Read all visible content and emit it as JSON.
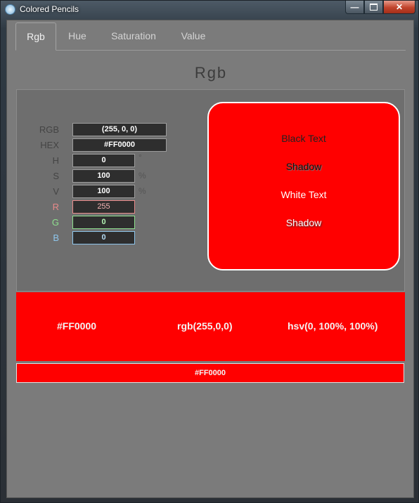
{
  "window": {
    "title": "Colored Pencils"
  },
  "tabs": [
    {
      "label": "Rgb"
    },
    {
      "label": "Hue"
    },
    {
      "label": "Saturation"
    },
    {
      "label": "Value"
    }
  ],
  "heading": "Rgb",
  "fields": {
    "rgb": {
      "label": "RGB",
      "value": "(255, 0, 0)"
    },
    "hex": {
      "label": "HEX",
      "value": "#FF0000"
    },
    "h": {
      "label": "H",
      "value": "0",
      "unit": "°"
    },
    "s": {
      "label": "S",
      "value": "100",
      "unit": "%"
    },
    "v": {
      "label": "V",
      "value": "100",
      "unit": "%"
    },
    "r": {
      "label": "R",
      "value": "255"
    },
    "g": {
      "label": "G",
      "value": "0"
    },
    "b": {
      "label": "B",
      "value": "0"
    }
  },
  "swatch": {
    "lines": [
      "Black Text",
      "Shadow",
      "White Text",
      "Shadow"
    ],
    "color": "#FF0000"
  },
  "band": {
    "hex": "#FF0000",
    "rgb": "rgb(255,0,0)",
    "hsv": "hsv(0, 100%, 100%)"
  },
  "hexbar": "#FF0000",
  "colors": {
    "r_label": "#e88a8a",
    "g_label": "#8ee08e",
    "b_label": "#8ec6ec"
  }
}
